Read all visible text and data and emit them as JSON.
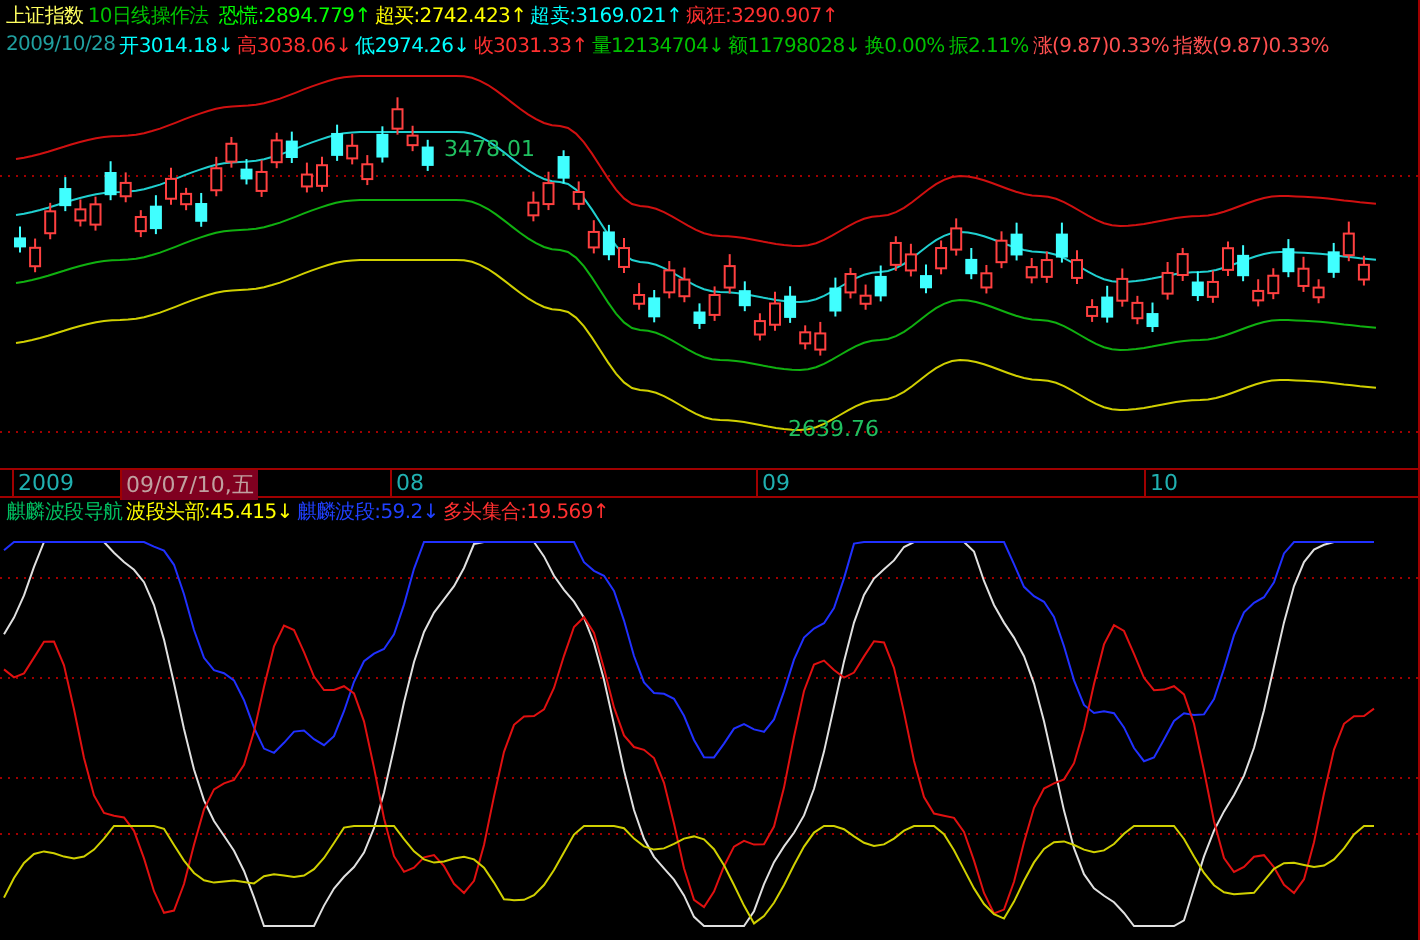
{
  "header": {
    "index_name": "上证指数",
    "method": "10日线操作法",
    "signals": [
      {
        "text": "恐慌:2894.779↑",
        "color": "#00ff00"
      },
      {
        "text": "超买:2742.423↑",
        "color": "#ffff00"
      },
      {
        "text": "超卖:3169.021↑",
        "color": "#00ffff"
      },
      {
        "text": "疯狂:3290.907↑",
        "color": "#ff3030"
      }
    ]
  },
  "quote": {
    "date": "2009/10/28",
    "fields": [
      {
        "text": "开3014.18↓",
        "color": "#00ffff"
      },
      {
        "text": "高3038.06↓",
        "color": "#ff3030"
      },
      {
        "text": "低2974.26↓",
        "color": "#00ffff"
      },
      {
        "text": "收3031.33↑",
        "color": "#ff3030"
      },
      {
        "text": "量12134704↓",
        "color": "#00c000"
      },
      {
        "text": "额11798028↓",
        "color": "#00c000"
      },
      {
        "text": "换0.00%",
        "color": "#00c000"
      },
      {
        "text": "振2.11%",
        "color": "#00c000"
      },
      {
        "text": "涨(9.87)0.33%",
        "color": "#ff5050"
      },
      {
        "text": "指数(9.87)0.33%",
        "color": "#ff5050"
      }
    ]
  },
  "price_chart": {
    "labels": [
      "3478.01",
      "2639.76"
    ]
  },
  "time_axis": {
    "ticks": [
      {
        "text": "2009",
        "selected": false
      },
      {
        "text": "09/07/10,五",
        "selected": true
      },
      {
        "text": "08",
        "selected": false
      },
      {
        "text": "09",
        "selected": false
      },
      {
        "text": "10",
        "selected": false
      }
    ]
  },
  "indicator_panel": {
    "title": "麒麟波段导航",
    "lines": [
      {
        "text": "波段头部:45.415↓",
        "color": "#ffff00"
      },
      {
        "text": "麒麟波段:59.2↓",
        "color": "#2040ff"
      },
      {
        "text": "多头集合:19.569↑",
        "color": "#ff3030"
      }
    ]
  }
}
